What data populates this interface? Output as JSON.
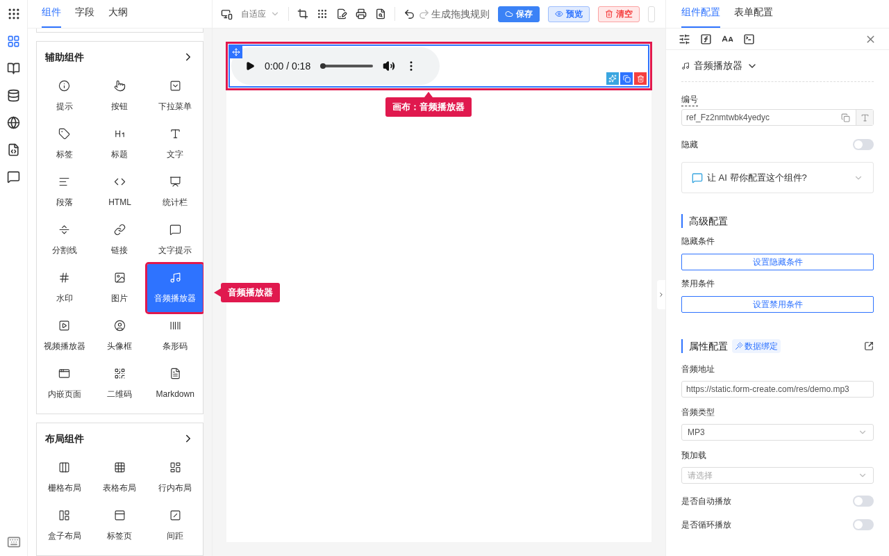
{
  "rail": [
    {
      "selected": true
    },
    {
      "selected": false
    },
    {
      "selected": false
    },
    {
      "selected": false
    },
    {
      "selected": false
    },
    {
      "selected": false
    }
  ],
  "left_tabs": [
    {
      "label": "组件",
      "selected": true
    },
    {
      "label": "字段",
      "selected": false
    },
    {
      "label": "大纲",
      "selected": false
    }
  ],
  "groups": [
    {
      "title": "辅助组件",
      "items": [
        {
          "label": "提示",
          "selected": false
        },
        {
          "label": "按钮",
          "selected": false
        },
        {
          "label": "下拉菜单",
          "selected": false
        },
        {
          "label": "标签",
          "selected": false
        },
        {
          "label": "标题",
          "selected": false
        },
        {
          "label": "文字",
          "selected": false
        },
        {
          "label": "段落",
          "selected": false
        },
        {
          "label": "HTML",
          "selected": false
        },
        {
          "label": "统计栏",
          "selected": false
        },
        {
          "label": "分割线",
          "selected": false
        },
        {
          "label": "链接",
          "selected": false
        },
        {
          "label": "文字提示",
          "selected": false
        },
        {
          "label": "水印",
          "selected": false
        },
        {
          "label": "图片",
          "selected": false
        },
        {
          "label": "音频播放器",
          "selected": true
        },
        {
          "label": "视频播放器",
          "selected": false
        },
        {
          "label": "头像框",
          "selected": false
        },
        {
          "label": "条形码",
          "selected": false
        },
        {
          "label": "内嵌页面",
          "selected": false
        },
        {
          "label": "二维码",
          "selected": false
        },
        {
          "label": "Markdown",
          "selected": false
        }
      ]
    },
    {
      "title": "布局组件",
      "items": [
        {
          "label": "栅格布局",
          "selected": false
        },
        {
          "label": "表格布局",
          "selected": false
        },
        {
          "label": "行内布局",
          "selected": false
        },
        {
          "label": "盒子布局",
          "selected": false
        },
        {
          "label": "标签页",
          "selected": false
        },
        {
          "label": "间距",
          "selected": false
        }
      ]
    }
  ],
  "toolbar": {
    "device": "自适应",
    "rule_button": "生成拖拽规则",
    "buttons": [
      {
        "label": "保存",
        "kind": "primary"
      },
      {
        "label": "预览",
        "kind": "info"
      },
      {
        "label": "清空",
        "kind": "danger"
      }
    ]
  },
  "canvas": {
    "player": {
      "time": "0:00 / 0:18",
      "level": 0
    }
  },
  "callouts": {
    "canvas": "画布：音频播放器",
    "item": "音频播放器"
  },
  "right_tabs": [
    {
      "label": "组件配置",
      "selected": true
    },
    {
      "label": "表单配置",
      "selected": false
    }
  ],
  "component": {
    "name": "音频播放器",
    "id_label": "编号",
    "id_value": "ref_Fz2nmtwbk4yedyc",
    "hidden_label": "隐藏",
    "hidden_on": false,
    "ai_prompt": "让 AI 帮你配置这个组件?"
  },
  "advanced": {
    "title": "高级配置",
    "rows": [
      {
        "label": "隐藏条件",
        "button": "设置隐藏条件"
      },
      {
        "label": "禁用条件",
        "button": "设置禁用条件"
      }
    ]
  },
  "props": {
    "title": "属性配置",
    "binding": "数据绑定",
    "fields": [
      {
        "kind": "input",
        "label": "音频地址",
        "value": "https://static.form-create.com/res/demo.mp3"
      },
      {
        "kind": "select",
        "label": "音频类型",
        "value": "MP3"
      },
      {
        "kind": "select",
        "label": "预加载",
        "placeholder": "请选择"
      },
      {
        "kind": "switch",
        "label": "是否自动播放",
        "on": false
      },
      {
        "kind": "switch",
        "label": "是否循环播放",
        "on": false
      }
    ]
  }
}
